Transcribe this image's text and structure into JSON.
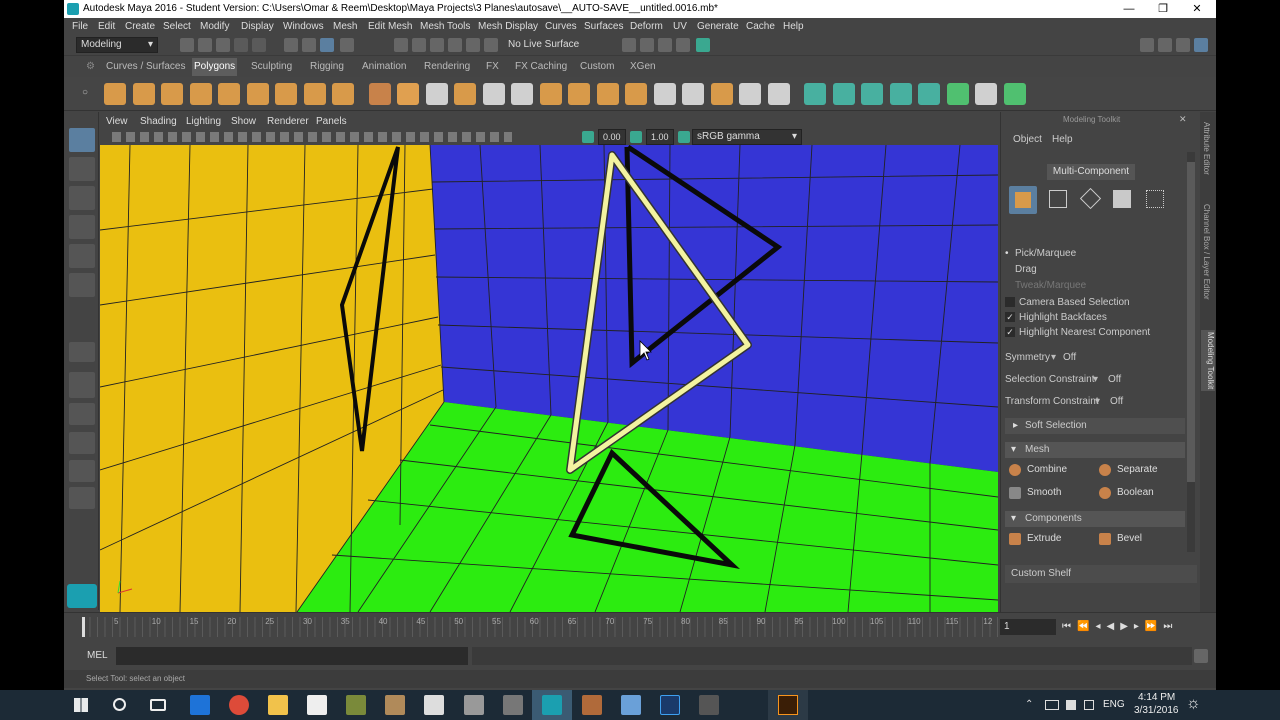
{
  "window": {
    "title": "Autodesk Maya 2016 - Student Version: C:\\Users\\Omar & Reem\\Desktop\\Maya Projects\\3 Planes\\autosave\\__AUTO-SAVE__untitled.0016.mb*",
    "min": "—",
    "max": "❐",
    "close": "✕"
  },
  "menubar": [
    "File",
    "Edit",
    "Create",
    "Select",
    "Modify",
    "Display",
    "Windows",
    "Mesh",
    "Edit Mesh",
    "Mesh Tools",
    "Mesh Display",
    "Curves",
    "Surfaces",
    "Deform",
    "UV",
    "Generate",
    "Cache",
    "Help"
  ],
  "statusline": {
    "menuset": "Modeling",
    "live_surface": "No Live Surface"
  },
  "shelf": {
    "tabs": [
      "Curves / Surfaces",
      "Polygons",
      "Sculpting",
      "Rigging",
      "Animation",
      "Rendering",
      "FX",
      "FX Caching",
      "Custom",
      "XGen"
    ],
    "active_tab": "Polygons",
    "icon_colors": [
      "#d89a4a",
      "#d89a4a",
      "#d89a4a",
      "#d89a4a",
      "#d89a4a",
      "#d89a4a",
      "#d89a4a",
      "#d89a4a",
      "#d89a4a",
      "#c8824a",
      "#e0a050",
      "#d0d0d0",
      "#d89a4a",
      "#d0d0d0",
      "#d0d0d0",
      "#d89a4a",
      "#d89a4a",
      "#d89a4a",
      "#d89a4a",
      "#d0d0d0",
      "#d0d0d0",
      "#d89a4a",
      "#d0d0d0",
      "#d0d0d0",
      "#48b0a0",
      "#48b0a0",
      "#48b0a0",
      "#48b0a0",
      "#48b0a0",
      "#50c070",
      "#d0d0d0",
      "#50c070"
    ]
  },
  "viewport": {
    "menu": [
      "View",
      "Shading",
      "Lighting",
      "Show",
      "Renderer",
      "Panels"
    ],
    "near": "0.00",
    "far": "1.00",
    "color_mgmt": "sRGB gamma",
    "colors": {
      "yellow": "#eabf10",
      "blue": "#3535d5",
      "green": "#2cec10",
      "selected": "#f3f3a0",
      "edge": "#0a0a0a"
    }
  },
  "modeling_toolkit": {
    "header": "Modeling Toolkit",
    "menus": [
      "Object",
      "Help"
    ],
    "mode": "Multi-Component",
    "pick_options": [
      "Pick/Marquee",
      "Drag",
      "Tweak/Marquee"
    ],
    "checkboxes": [
      {
        "label": "Camera Based Selection",
        "checked": false
      },
      {
        "label": "Highlight Backfaces",
        "checked": true
      },
      {
        "label": "Highlight Nearest Component",
        "checked": true
      }
    ],
    "symmetry": {
      "label": "Symmetry",
      "value": "Off"
    },
    "selection_constraint": {
      "label": "Selection Constraint",
      "value": "Off"
    },
    "transform_constraint": {
      "label": "Transform Constraint",
      "value": "Off"
    },
    "soft_selection": "Soft Selection",
    "mesh_section": "Mesh",
    "mesh_buttons": [
      "Combine",
      "Separate",
      "Smooth",
      "Boolean"
    ],
    "components_section": "Components",
    "component_buttons": [
      "Extrude",
      "Bevel"
    ],
    "custom_shelf": "Custom Shelf"
  },
  "side_tabs": [
    "Attribute Editor",
    "Channel Box / Layer Editor",
    "Modeling Toolkit"
  ],
  "timeline": {
    "ticks": [
      "5",
      "10",
      "15",
      "20",
      "25",
      "30",
      "35",
      "40",
      "45",
      "50",
      "55",
      "60",
      "65",
      "70",
      "75",
      "80",
      "85",
      "90",
      "95",
      "100",
      "105",
      "110",
      "115",
      "12"
    ],
    "current_frame": "1"
  },
  "cmdline": {
    "label": "MEL"
  },
  "helpline": "Select Tool: select an object",
  "taskbar": {
    "lang": "ENG",
    "time": "4:14 PM",
    "date": "3/31/2016"
  }
}
